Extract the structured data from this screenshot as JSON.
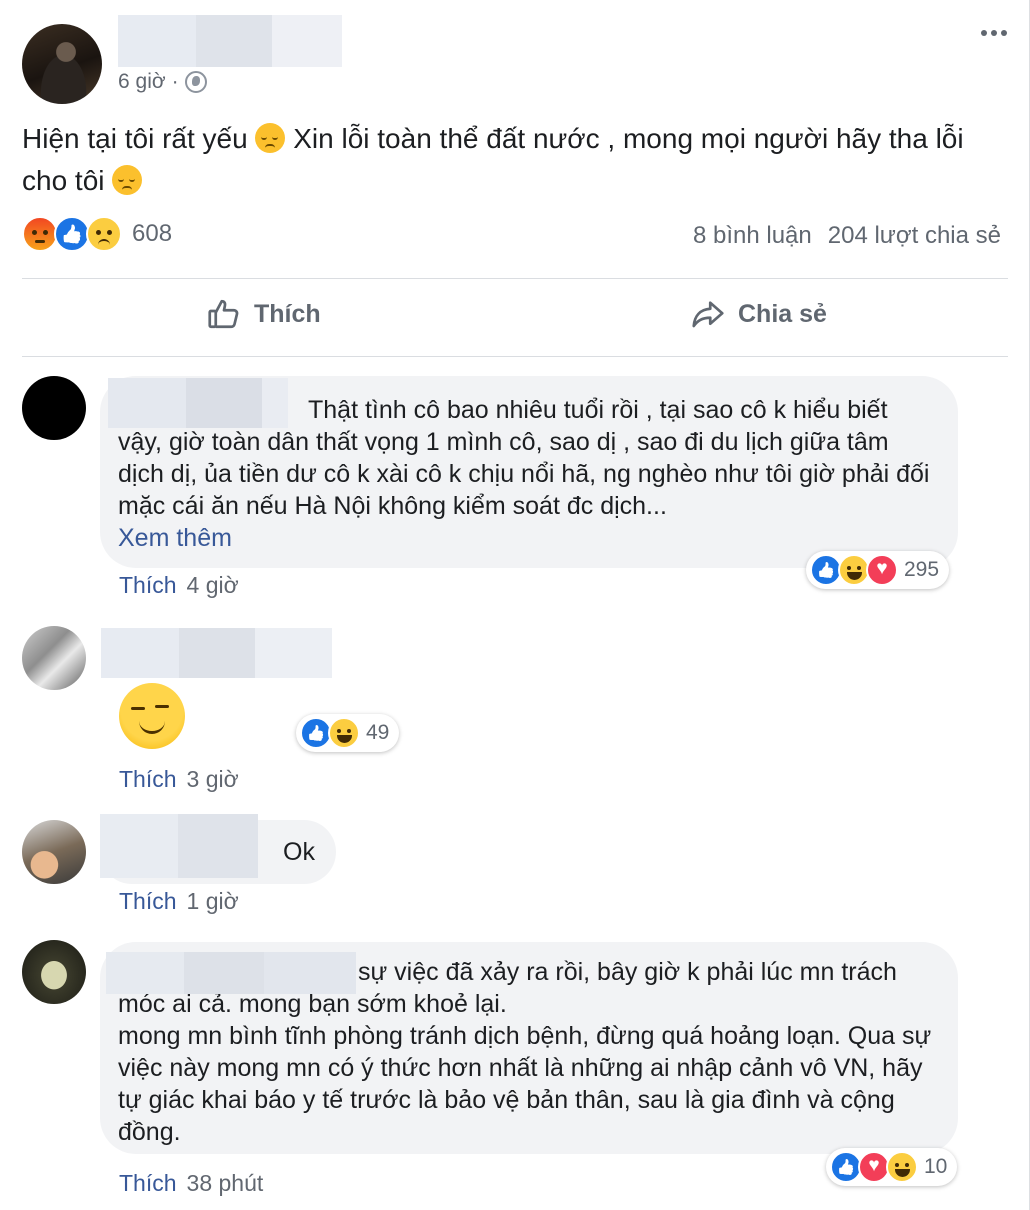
{
  "post": {
    "time": "6 giờ",
    "separator": "·",
    "text_part1": "Hiện tại tôi rất yếu ",
    "text_part2": " Xin lỗi toàn thể đất nước , mong mọi người hãy tha lỗi cho tôi ",
    "reaction_count": "608",
    "comments_count": "8 bình luận",
    "shares_count": "204 lượt chia sẻ",
    "like_label": "Thích",
    "share_label": "Chia sẻ",
    "reactions": [
      "angry",
      "like",
      "sad"
    ]
  },
  "comments": [
    {
      "text": "Thật tình cô bao nhiêu tuổi rồi , tại sao cô k hiểu biết vậy, giờ toàn dân thất vọng 1 mình cô, sao dị , sao đi du lịch giữa tâm dịch dị, ủa tiền dư cô k xài cô k chịu nổi hã, ng nghèo như tôi giờ phải đối mặc cái ăn nếu Hà Nội không kiểm soát đc dịch...",
      "see_more": "Xem thêm",
      "like_label": "Thích",
      "time": "4 giờ",
      "reaction_count": "295",
      "reactions": [
        "like",
        "haha",
        "love"
      ]
    },
    {
      "emoji": "smirk-emoji",
      "like_label": "Thích",
      "time": "3 giờ",
      "reaction_count": "49",
      "reactions": [
        "like",
        "haha"
      ]
    },
    {
      "text": "Ok",
      "like_label": "Thích",
      "time": "1 giờ"
    },
    {
      "text": "sự việc đã xảy ra rồi, bây giờ k phải lúc mn trách móc ai cả. mong bạn sớm khoẻ lại.",
      "text2": "mong mn bình tĩnh phòng tránh dịch bệnh, đừng quá hoảng loạn. Qua sự việc này mong mn có ý thức hơn nhất là những ai nhập cảnh vô VN, hãy tự giác khai báo y tế trước là bảo vệ bản thân, sau là gia đình và cộng đồng.",
      "like_label": "Thích",
      "time": "38 phút",
      "reaction_count": "10",
      "reactions": [
        "like",
        "love",
        "haha"
      ]
    }
  ],
  "colors": {
    "link": "#385898",
    "meta": "#616770",
    "bubble": "#f2f3f5",
    "like_blue": "#1b74e4",
    "love_red": "#f33e58",
    "emoji_yellow": "#fbcd40"
  }
}
